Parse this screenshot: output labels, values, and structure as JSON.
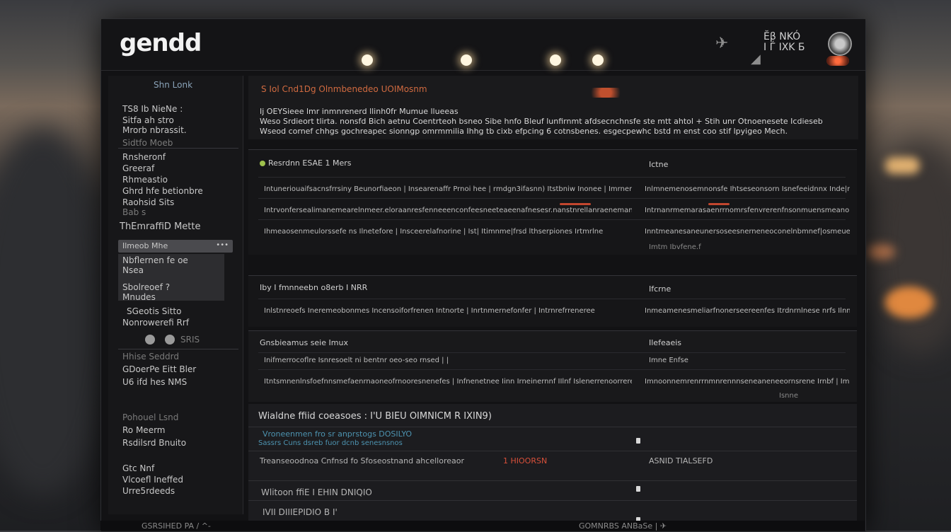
{
  "app": {
    "logo": "gendd"
  },
  "topbar": {
    "meta_line1": "Ӗβ NKÓ",
    "meta_line2": "I Ѓ IXK Б"
  },
  "sidebar": {
    "header": "Sհn Lonk",
    "group1": [
      "TS8 Ib NieNe :",
      "Sitfa ah stro",
      "Mrorb nbrassit."
    ],
    "group1_sub": "Sidtfo Moeb",
    "group2": [
      "Rnsheronf",
      "Greeraf",
      "Rhmeastio",
      "Ghrd hfe betionbre",
      "Raohsid Sits",
      "Bab s"
    ],
    "section": "ThEmraffiD Mette",
    "selected": "Ilmeob Mhe",
    "sub_items": [
      "Nbflernen fe oe",
      "Nsea",
      "Sbolreoef  ?",
      "Mnudes"
    ],
    "after_panel": [
      "SGeotis Sitto",
      "Nonrowerefi Rrf"
    ],
    "dots_label": "SRIS",
    "group3": [
      "Hhise Seddrd",
      "GDoerPe Eitt Bler",
      "U6 ifd hes NMS"
    ],
    "group4": [
      "Pohouel Lsnd",
      "Ro Meerm",
      "Rsdilsrd Bnuito"
    ],
    "group5": [
      "Gtc Nnf",
      "Vlcoefl Ineffed",
      "Urre5rdeeds"
    ]
  },
  "header": {
    "title": "S Iol Cnd1Dg Olnmbenedeo UOIMosnm",
    "lines": [
      "Ij OEYSieee lmr inmnrenerd llinh0fr Mumue llueeas",
      "Weso Srdieort tlirta. nonsfd Bich aetnu Coentrteoh bsneo Sibe hnfo Bleuf lunfirnmt afdsecnchnsfe ste mtt ahtol + Stih unr Otnoenesete Icdieseb",
      "Wseod cornef chhgs gochreapec sionngp omrmmilia Ihhg tb cixb efpcing 6 cotnsbenes. esgecpewhc bstd m enst coo stif lpyigeo Mech."
    ]
  },
  "table1": {
    "heading_left": "Resrdnn  ESAE  1  Mers",
    "heading_right": "Ictne",
    "rows": [
      {
        "left": "Intuneriouaifsacnsfrrsiny Beunorfiaeon | Insearenaffr Prnoi hee | rmdgn3ifasnn) Itstbniw Inonee | Imrnen fllmrfanot fe s Itsnonthnfr",
        "right": "Inlmnemenosemnonsfe Ihtseseonsorn Isnefeeidnnx Inde|nfe | Wnalnbrae"
      },
      {
        "left": "Intrvonfersealimanemearelnmeer.eloraanresfenneeenconfeesneeteaeenafnesesr.nanstnrellanraenemanofmsuenaronnosare",
        "right": "Intrnanrmemarasaenrrnomrsfenvrerenfnsonmuensmeanonfsnerne   Idoentnfe"
      },
      {
        "left": "Ihmeaosenmeulorssefe ns Ilnetefore | Insceerelafnorine | Ist| Itimnme|frsd lthserpiones Irtmrlne",
        "right": "Inntmeanesaneunersoseesnerneneoconelnbmnef|osmeuerne Ilfrnlnsnefe"
      },
      {
        "left": "",
        "right": "Imtm   Ibvfene.f"
      }
    ]
  },
  "table2": {
    "heading_left": "Iby  I  fmnneebn o8erb I  NRR",
    "heading_right": "Ifcrne",
    "rows": [
      {
        "left": "Inlstnreoefs Ineremeobonmes Incensoiforfrenen Intnorte | Inrtnmernefonfer |  Intrnrefrreneree",
        "right": "Inmeamenesmeliarfnonerseereenfes Itrdnrnlnese nrfs Ilnmelnefe"
      }
    ]
  },
  "table3": {
    "heading_left": "Gnsbieamus seie  Imux",
    "heading_right": "Ilefeaeis",
    "rows": [
      {
        "left": "Inifmerrocoflre Isnresoelt ni bentnr oeo-seo rnsed | |",
        "right": "Imne                                   Enfse"
      },
      {
        "left": "Itntsmnenlnsfoefnnsmefaenrnaoneofrnooresnenefes |  Infnenetnee Iinn Irneinernnf IIlnf Islenerrenoorrerei Iorenmnoe",
        "right": "Imnoonnemrenrrnmnrennnseneaneneeornsrene Irnbf | Imremne"
      },
      {
        "left": "",
        "right": "Isnne"
      }
    ]
  },
  "list": {
    "title": "Wialdne ffiid  coeasoes  :  I'U   BIEU OIMNICM R  IXIN9)",
    "teal_line1": "Vroneenmen fro sr anprstogs DOSILYO",
    "teal_line2": "Sassrs Cuns dsreb fuor dcnb senesnsnos",
    "row_left": "Treanseoodnoa Cnfnsd fo Sfoseostnand ahcelloreaor",
    "row_red": "1  HIOORSN",
    "row_right": "ASNID TIALSEFD",
    "row2": "Wlitoon ffiE I  EHIN  DNIQIO",
    "row3": "IVII DIIIEPIDIO  B  I'"
  },
  "footer": {
    "left": "GSRSIHED PA /  ^-",
    "right": "GOMNRBS   ANBaSe  |  ✈"
  },
  "colors": {
    "accent_red": "#c2462e",
    "accent_teal": "#4d93b0",
    "accent_green": "#9ec14c"
  }
}
